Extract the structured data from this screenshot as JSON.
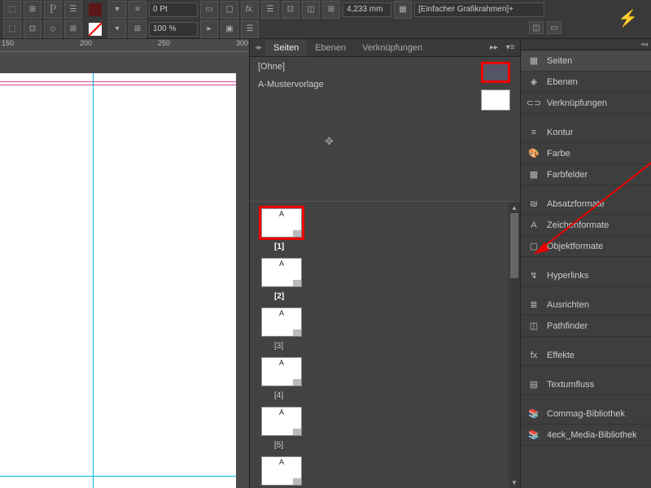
{
  "toolbar": {
    "stroke_weight": "0 Pt",
    "zoom": "100 %",
    "measure": "4,233 mm",
    "frame_style": "[Einfacher Grafikrahmen]+",
    "char_placeholder": "P"
  },
  "ruler": {
    "marks": [
      "150",
      "200",
      "250",
      "300"
    ]
  },
  "mid_panel": {
    "tabs": [
      "Seiten",
      "Ebenen",
      "Verknüpfungen"
    ],
    "active_tab": 0,
    "masters": [
      {
        "name": "[Ohne]"
      },
      {
        "name": "A-Mustervorlage"
      }
    ],
    "pages": [
      {
        "master": "A",
        "num": "[1]",
        "selected": true
      },
      {
        "master": "A",
        "num": "[2]",
        "bold": true
      },
      {
        "master": "A",
        "num": "[3]"
      },
      {
        "master": "A",
        "num": "[4]"
      },
      {
        "master": "A",
        "num": "[5]"
      },
      {
        "master": "A",
        "num": ""
      }
    ]
  },
  "right_panel": {
    "groups": [
      [
        {
          "icon": "▦",
          "label": "Seiten",
          "active": true
        },
        {
          "icon": "◈",
          "label": "Ebenen"
        },
        {
          "icon": "⊂⊃",
          "label": "Verknüpfungen"
        }
      ],
      [
        {
          "icon": "≡",
          "label": "Kontur"
        },
        {
          "icon": "🎨",
          "label": "Farbe"
        },
        {
          "icon": "▦",
          "label": "Farbfelder"
        }
      ],
      [
        {
          "icon": "₪",
          "label": "Absatzformate"
        },
        {
          "icon": "A",
          "label": "Zeichenformate"
        },
        {
          "icon": "▢",
          "label": "Objektformate"
        }
      ],
      [
        {
          "icon": "↯",
          "label": "Hyperlinks"
        }
      ],
      [
        {
          "icon": "≣",
          "label": "Ausrichten"
        },
        {
          "icon": "◫",
          "label": "Pathfinder"
        }
      ],
      [
        {
          "icon": "fx",
          "label": "Effekte"
        }
      ],
      [
        {
          "icon": "▤",
          "label": "Textumfluss"
        }
      ],
      [
        {
          "icon": "📚",
          "label": "Commag-Bibliothek"
        },
        {
          "icon": "📚",
          "label": "4eck_Media-Bibliothek"
        }
      ]
    ]
  }
}
